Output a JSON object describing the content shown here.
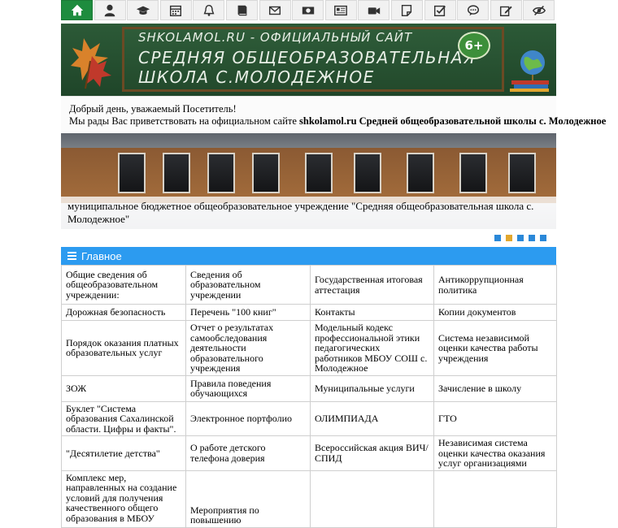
{
  "toolbar": {
    "icons": [
      "home-icon",
      "user-icon",
      "graduation-cap-icon",
      "calendar-icon",
      "bell-icon",
      "book-icon",
      "envelope-icon",
      "money-icon",
      "newspaper-icon",
      "video-camera-icon",
      "sticky-note-icon",
      "checkbox-icon",
      "comment-icon",
      "edit-icon",
      "eye-slash-icon"
    ],
    "accent": "#1e8c3e"
  },
  "banner": {
    "line1": "SHKOLAMOL.RU - ОФИЦИАЛЬНЫЙ САЙТ",
    "line2": "СРЕДНЯЯ ОБЩЕОБРАЗОВАТЕЛЬНАЯ",
    "line3": "ШКОЛА С.МОЛОДЕЖНОЕ",
    "badge": "6+"
  },
  "greeting": {
    "line1": "Добрый день, уважаемый Посетитель!",
    "line2_prefix": "Мы рады Вас приветствовать на официальном сайте ",
    "line2_bold": "shkolamol.ru Средней общеобразовательной школы с. Молодежное"
  },
  "slider": {
    "caption": "муниципальное бюджетное общеобразовательное учреждение \"Средняя общеобразовательная школа с. Молодежное\"",
    "dot_count": 5,
    "active_dot": 2,
    "dot_color": "#2a88d8",
    "active_color": "#e2a72e"
  },
  "menu": {
    "title": "Главное",
    "color": "#2c9bf0",
    "rows": [
      [
        "Общие сведения об общеобразовательном учреждении:",
        "Сведения об образовательном учреждении",
        "Государственная итоговая аттестация",
        "Антикоррупционная политика"
      ],
      [
        "Дорожная безопасность",
        "Перечень \"100 книг\"",
        "Контакты",
        "Копии документов"
      ],
      [
        "Порядок оказания платных образовательных услуг",
        "Отчет о результатах самообследования деятельности образовательного учреждения",
        "Модельный кодекс профессиональной этики педагогических работников МБОУ СОШ с. Молодежное",
        "Система независимой оценки качества работы учреждения"
      ],
      [
        "ЗОЖ",
        "Правила поведения обучающихся",
        "Муниципальные услуги",
        "Зачисление в школу"
      ],
      [
        "Буклет \"Система образования Сахалинской области. Цифры и факты\".",
        "Электронное портфолио",
        "ОЛИМПИАДА",
        "ГТО"
      ],
      [
        "\"Десятилетие детства\"",
        "О работе детского телефона доверия",
        "Всероссийская акция ВИЧ/СПИД",
        "Независимая система оценки качества оказания услуг организациями"
      ],
      [
        "Комплекс мер, направленных на создание условий для получения качественного общего образования в МБОУ",
        "Мероприятия по повышению",
        "",
        ""
      ]
    ]
  }
}
